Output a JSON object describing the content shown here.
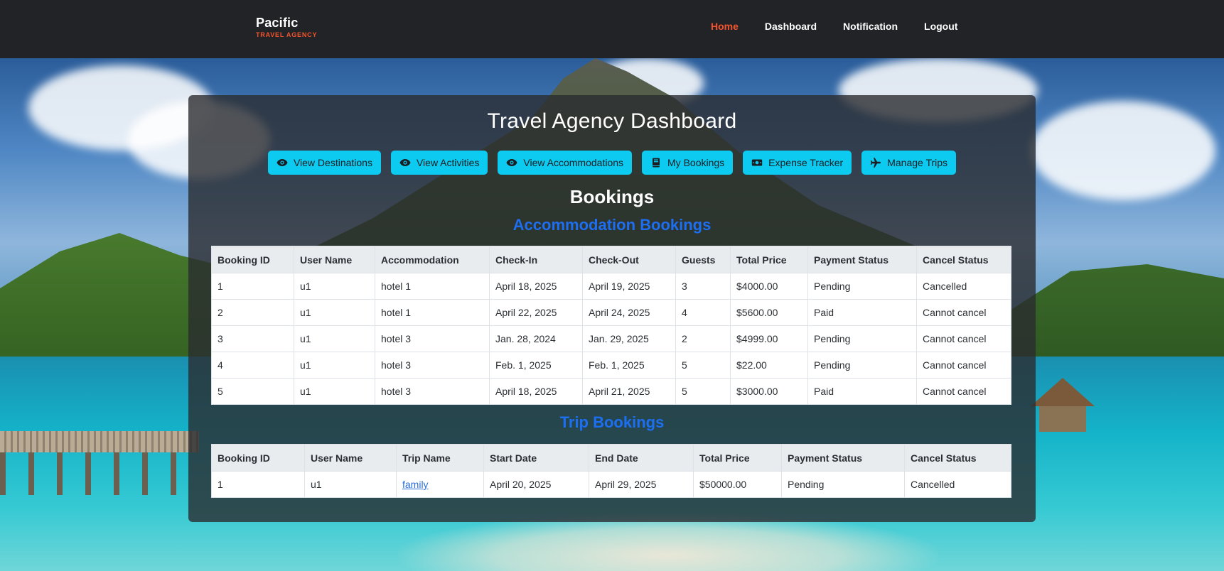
{
  "brand": {
    "name": "Pacific",
    "tagline": "TRAVEL AGENCY"
  },
  "nav": [
    {
      "label": "Home",
      "active": true
    },
    {
      "label": "Dashboard",
      "active": false
    },
    {
      "label": "Notification",
      "active": false
    },
    {
      "label": "Logout",
      "active": false
    }
  ],
  "page_title": "Travel Agency Dashboard",
  "actions": [
    {
      "label": "View Destinations",
      "icon": "eye-icon"
    },
    {
      "label": "View Activities",
      "icon": "eye-icon"
    },
    {
      "label": "View Accommodations",
      "icon": "eye-icon"
    },
    {
      "label": "My Bookings",
      "icon": "book-icon"
    },
    {
      "label": "Expense Tracker",
      "icon": "money-bill-icon"
    },
    {
      "label": "Manage Trips",
      "icon": "plane-icon"
    }
  ],
  "bookings_heading": "Bookings",
  "accommodation": {
    "heading": "Accommodation Bookings",
    "columns": [
      "Booking ID",
      "User Name",
      "Accommodation",
      "Check-In",
      "Check-Out",
      "Guests",
      "Total Price",
      "Payment Status",
      "Cancel Status"
    ],
    "rows": [
      {
        "id": "1",
        "user": "u1",
        "accommodation": "hotel 1",
        "check_in": "April 18, 2025",
        "check_out": "April 19, 2025",
        "guests": "3",
        "price": "$4000.00",
        "payment": "Pending",
        "cancel": "Cancelled"
      },
      {
        "id": "2",
        "user": "u1",
        "accommodation": "hotel 1",
        "check_in": "April 22, 2025",
        "check_out": "April 24, 2025",
        "guests": "4",
        "price": "$5600.00",
        "payment": "Paid",
        "cancel": "Cannot cancel"
      },
      {
        "id": "3",
        "user": "u1",
        "accommodation": "hotel 3",
        "check_in": "Jan. 28, 2024",
        "check_out": "Jan. 29, 2025",
        "guests": "2",
        "price": "$4999.00",
        "payment": "Pending",
        "cancel": "Cannot cancel"
      },
      {
        "id": "4",
        "user": "u1",
        "accommodation": "hotel 3",
        "check_in": "Feb. 1, 2025",
        "check_out": "Feb. 1, 2025",
        "guests": "5",
        "price": "$22.00",
        "payment": "Pending",
        "cancel": "Cannot cancel"
      },
      {
        "id": "5",
        "user": "u1",
        "accommodation": "hotel 3",
        "check_in": "April 18, 2025",
        "check_out": "April 21, 2025",
        "guests": "5",
        "price": "$3000.00",
        "payment": "Paid",
        "cancel": "Cannot cancel"
      }
    ]
  },
  "trips": {
    "heading": "Trip Bookings",
    "columns": [
      "Booking ID",
      "User Name",
      "Trip Name",
      "Start Date",
      "End Date",
      "Total Price",
      "Payment Status",
      "Cancel Status"
    ],
    "rows": [
      {
        "id": "1",
        "user": "u1",
        "trip": "family",
        "start": "April 20, 2025",
        "end": "April 29, 2025",
        "price": "$50000.00",
        "payment": "Pending",
        "cancel": "Cancelled"
      }
    ]
  },
  "colors": {
    "nav_bg": "#212327",
    "accent_orange": "#f2542d",
    "button_cyan": "#0dcaf0",
    "heading_blue": "#1d6ff2",
    "pending": "#f0b400",
    "paid": "#198754"
  }
}
